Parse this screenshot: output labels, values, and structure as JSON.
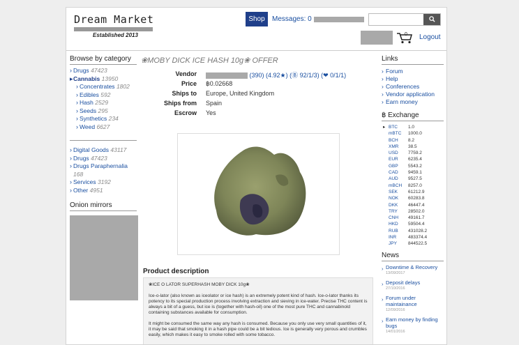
{
  "header": {
    "logo_title": "Dream Market",
    "logo_tagline": "Established 2013",
    "shop_label": "Shop",
    "messages_label": "Messages: 0",
    "search_button": "🔍",
    "cart_count": "0",
    "logout_label": "Logout"
  },
  "sidebar": {
    "browse_heading": "Browse by category",
    "categories": [
      {
        "label": "Drugs",
        "count": "47423",
        "sub": false,
        "active": false
      },
      {
        "label": "Cannabis",
        "count": "13950",
        "sub": false,
        "active": true
      },
      {
        "label": "Concentrates",
        "count": "1802",
        "sub": true,
        "active": false
      },
      {
        "label": "Edibles",
        "count": "592",
        "sub": true,
        "active": false
      },
      {
        "label": "Hash",
        "count": "2529",
        "sub": true,
        "active": false
      },
      {
        "label": "Seeds",
        "count": "295",
        "sub": true,
        "active": false
      },
      {
        "label": "Synthetics",
        "count": "234",
        "sub": true,
        "active": false
      },
      {
        "label": "Weed",
        "count": "6627",
        "sub": true,
        "active": false
      }
    ],
    "categories2": [
      {
        "label": "Digital Goods",
        "count": "43117"
      },
      {
        "label": "Drugs",
        "count": "47423"
      },
      {
        "label": "Drugs Paraphernalia",
        "count": "168"
      },
      {
        "label": "Services",
        "count": "3192"
      },
      {
        "label": "Other",
        "count": "4951"
      }
    ],
    "mirrors_heading": "Onion mirrors"
  },
  "product": {
    "title": "❀MOBY DICK ICE HASH 10g❀ OFFER",
    "vendor_label": "Vendor",
    "vendor_stats": "(390) (4.92★) (Ⓑ 92/1/3) (❤ 0/1/1)",
    "price_label": "Price",
    "price_value": "฿0.02668",
    "ships_to_label": "Ships to",
    "ships_to_value": "Europe, United Kingdom",
    "ships_from_label": "Ships from",
    "ships_from_value": "Spain",
    "escrow_label": "Escrow",
    "escrow_value": "Yes",
    "description_heading": "Product description",
    "description_paragraphs": [
      "❀ICE O LATOR SUPERHASH MOBY DICK 10g❀",
      "Ice-o-lator (also known as iceolator or ice hash) is an extremely potent kind of hash. Ice-o-lator thanks its potency to its special production process involving extraction and sieving in ice-water. Precise THC content is always a bit of a guess, but ice is (together with hash-oil) one of the most pure THC and cannabinold containing substances available for consumption.",
      "It might be consumed the same way any hash is consumed. Because you only use very small quantities of it, it may be said that smoking it in a hash pipe could be a bit tedious. Ice is generally very porous and crumbles easily, which makes it easy to smoke rolled with some tobacco."
    ]
  },
  "right": {
    "links_heading": "Links",
    "links": [
      "Forum",
      "Help",
      "Conferences",
      "Vendor application",
      "Earn money"
    ],
    "exchange_heading": "฿ Exchange",
    "exchange": [
      {
        "cur": "BTC",
        "val": "1.0"
      },
      {
        "cur": "mBTC",
        "val": "1000.0"
      },
      {
        "cur": "BCH",
        "val": "8.2"
      },
      {
        "cur": "XMR",
        "val": "38.5"
      },
      {
        "cur": "USD",
        "val": "7759.2"
      },
      {
        "cur": "EUR",
        "val": "6235.4"
      },
      {
        "cur": "GBP",
        "val": "5543.2"
      },
      {
        "cur": "CAD",
        "val": "9459.1"
      },
      {
        "cur": "AUD",
        "val": "9527.5"
      },
      {
        "cur": "mBCH",
        "val": "8257.0"
      },
      {
        "cur": "SEK",
        "val": "61212.9"
      },
      {
        "cur": "NOK",
        "val": "60283.8"
      },
      {
        "cur": "DKK",
        "val": "46447.4"
      },
      {
        "cur": "TRY",
        "val": "28502.0"
      },
      {
        "cur": "CNH",
        "val": "49161.7"
      },
      {
        "cur": "HKD",
        "val": "59504.4"
      },
      {
        "cur": "RUB",
        "val": "431028.2"
      },
      {
        "cur": "INR",
        "val": "483374.4"
      },
      {
        "cur": "JPY",
        "val": "844522.5"
      }
    ],
    "news_heading": "News",
    "news": [
      {
        "title": "Downtime & Recovery",
        "date": "13/09/2017"
      },
      {
        "title": "Deposit delays",
        "date": "27/10/2016"
      },
      {
        "title": "Forum under maintainance",
        "date": "12/09/2016"
      },
      {
        "title": "Earn money by finding bugs",
        "date": "14/01/2016"
      }
    ]
  }
}
